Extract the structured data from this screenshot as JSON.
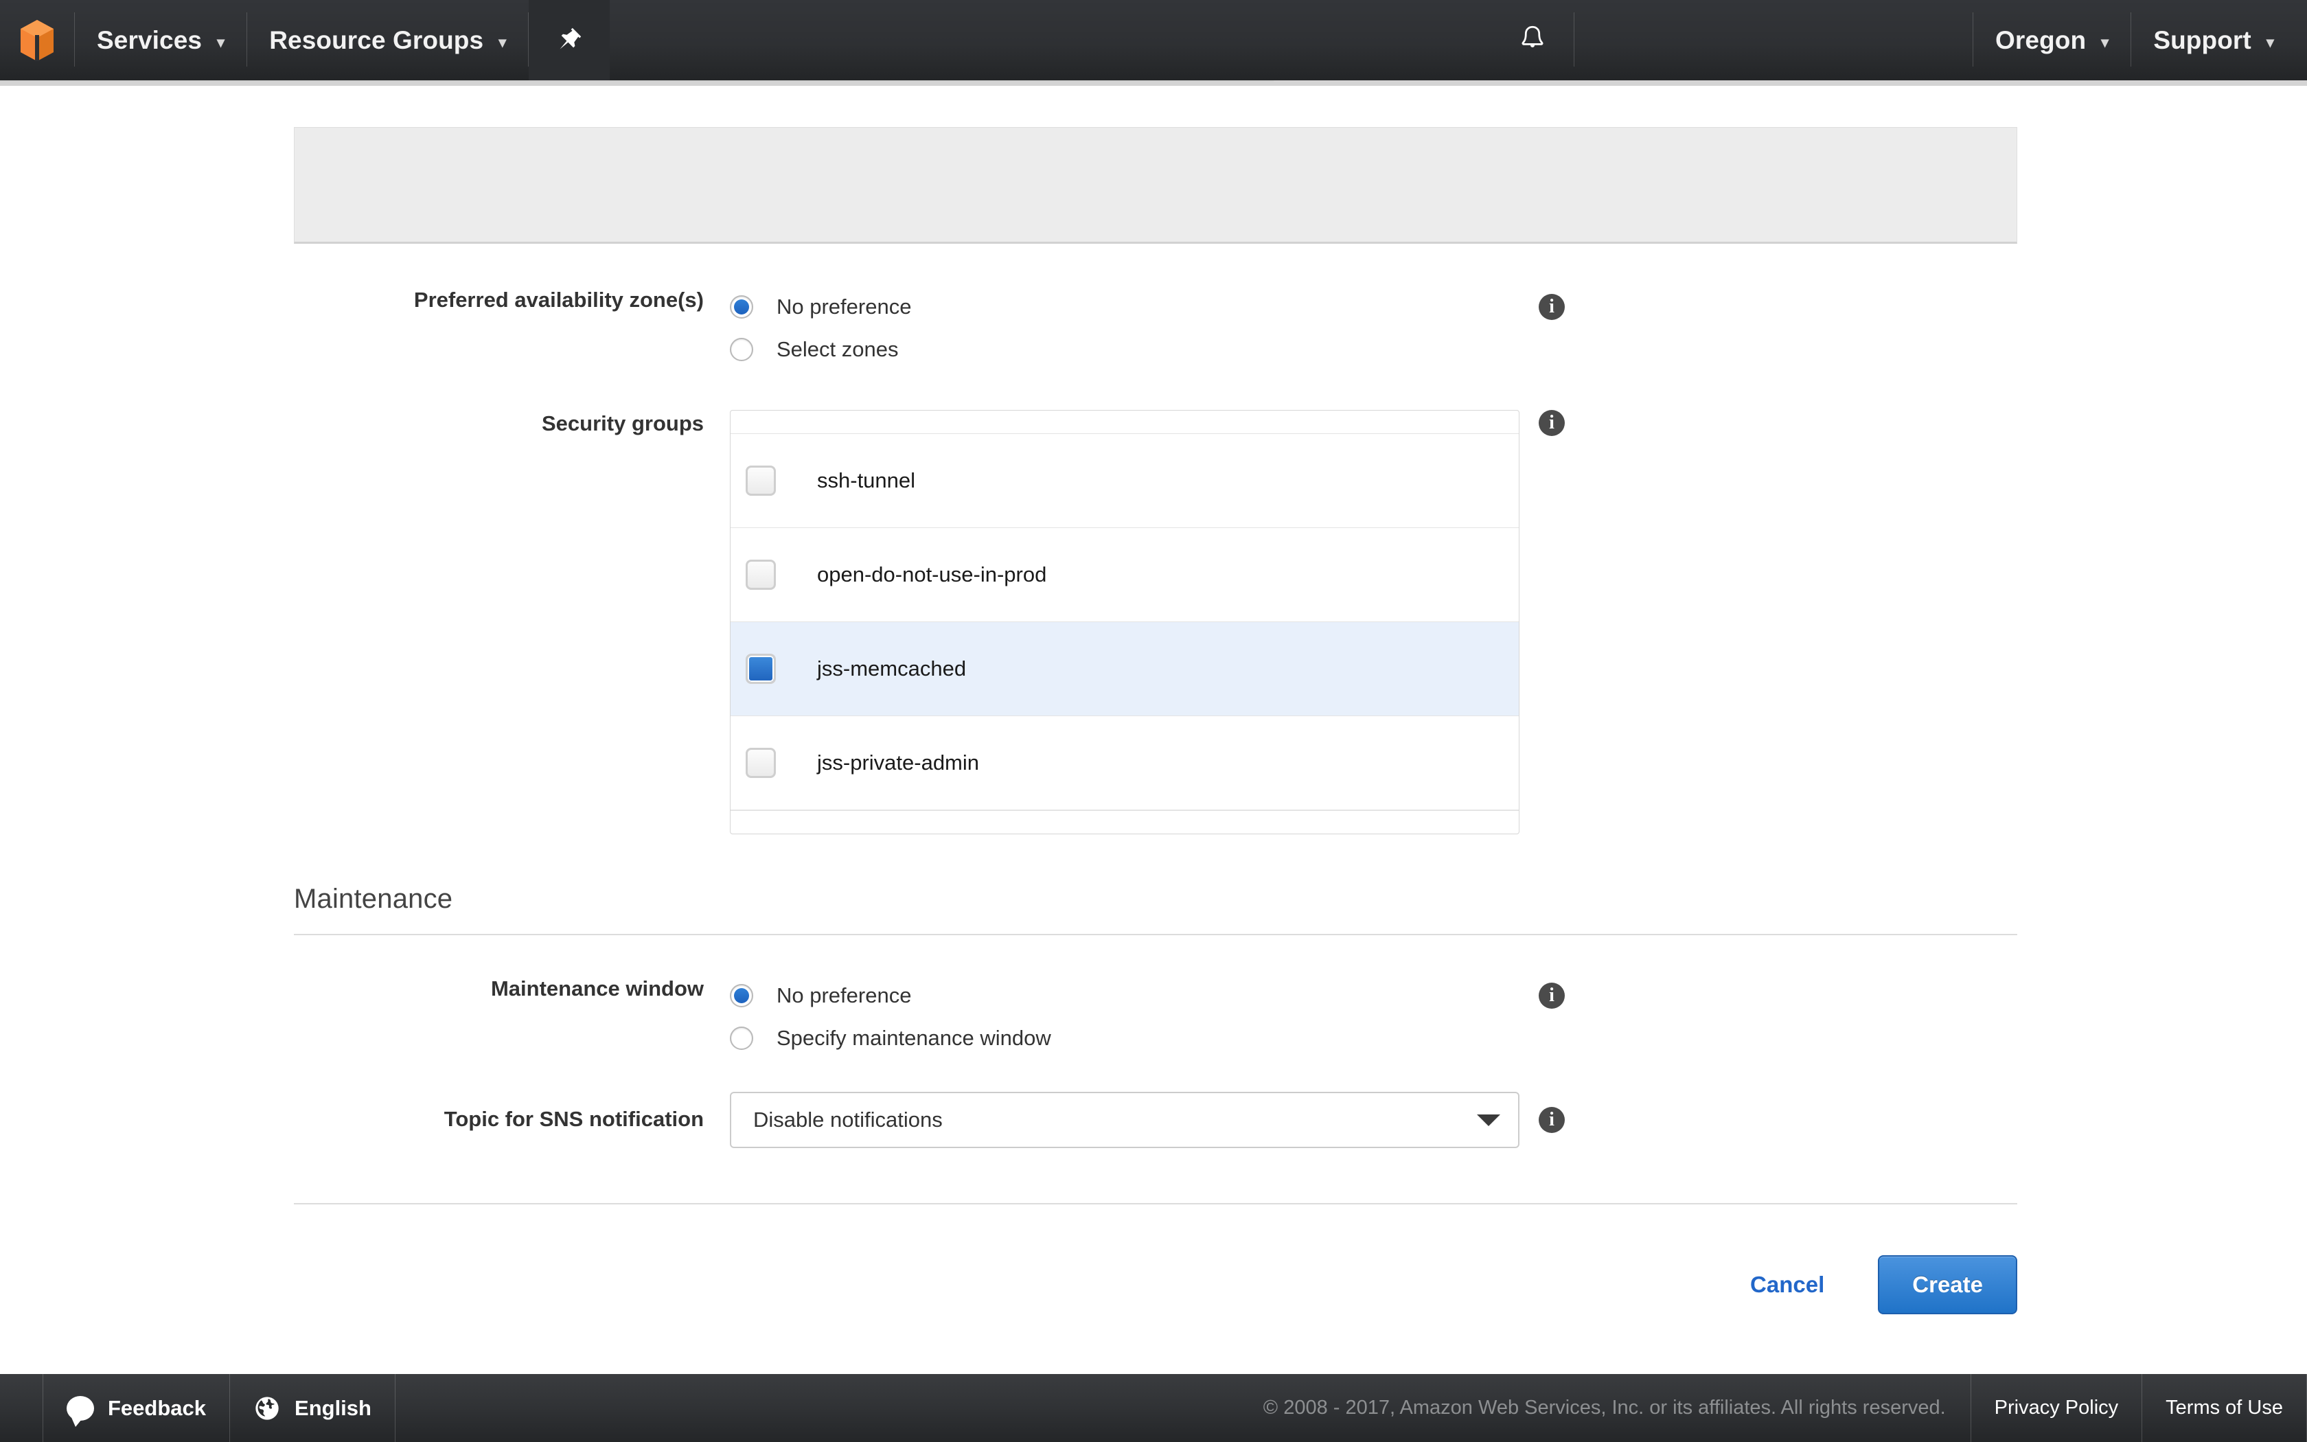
{
  "navbar": {
    "logo_icon": "aws-cube-icon",
    "services_label": "Services",
    "resource_groups_label": "Resource Groups",
    "pin_icon": "pin-icon",
    "bell_icon": "bell-icon",
    "region_label": "Oregon",
    "support_label": "Support",
    "caret_glyph": "▾"
  },
  "form": {
    "availability": {
      "label": "Preferred availability zone(s)",
      "options": [
        {
          "label": "No preference",
          "checked": true
        },
        {
          "label": "Select zones",
          "checked": false
        }
      ],
      "info_icon": "info-icon"
    },
    "security_groups": {
      "label": "Security groups",
      "info_icon": "info-icon",
      "items": [
        {
          "name": "ssh-tunnel",
          "checked": false
        },
        {
          "name": "open-do-not-use-in-prod",
          "checked": false
        },
        {
          "name": "jss-memcached",
          "checked": true
        },
        {
          "name": "jss-private-admin",
          "checked": false
        }
      ]
    },
    "maintenance": {
      "section_title": "Maintenance",
      "window_label": "Maintenance window",
      "window_options": [
        {
          "label": "No preference",
          "checked": true
        },
        {
          "label": "Specify maintenance window",
          "checked": false
        }
      ],
      "window_info_icon": "info-icon",
      "sns_label": "Topic for SNS notification",
      "sns_value": "Disable notifications",
      "sns_info_icon": "info-icon",
      "sns_caret_icon": "chevron-down-icon"
    },
    "actions": {
      "cancel_label": "Cancel",
      "create_label": "Create"
    }
  },
  "footer": {
    "feedback_label": "Feedback",
    "feedback_icon": "speech-bubble-icon",
    "language_label": "English",
    "language_icon": "globe-icon",
    "copyright": "© 2008 - 2017, Amazon Web Services, Inc. or its affiliates. All rights reserved.",
    "privacy_label": "Privacy Policy",
    "terms_label": "Terms of Use"
  },
  "colors": {
    "accent_blue": "#2073c8",
    "link_blue": "#2267c9",
    "selected_row": "#e8f0fb",
    "nav_dark": "#2e3033",
    "aws_orange": "#f58536"
  }
}
